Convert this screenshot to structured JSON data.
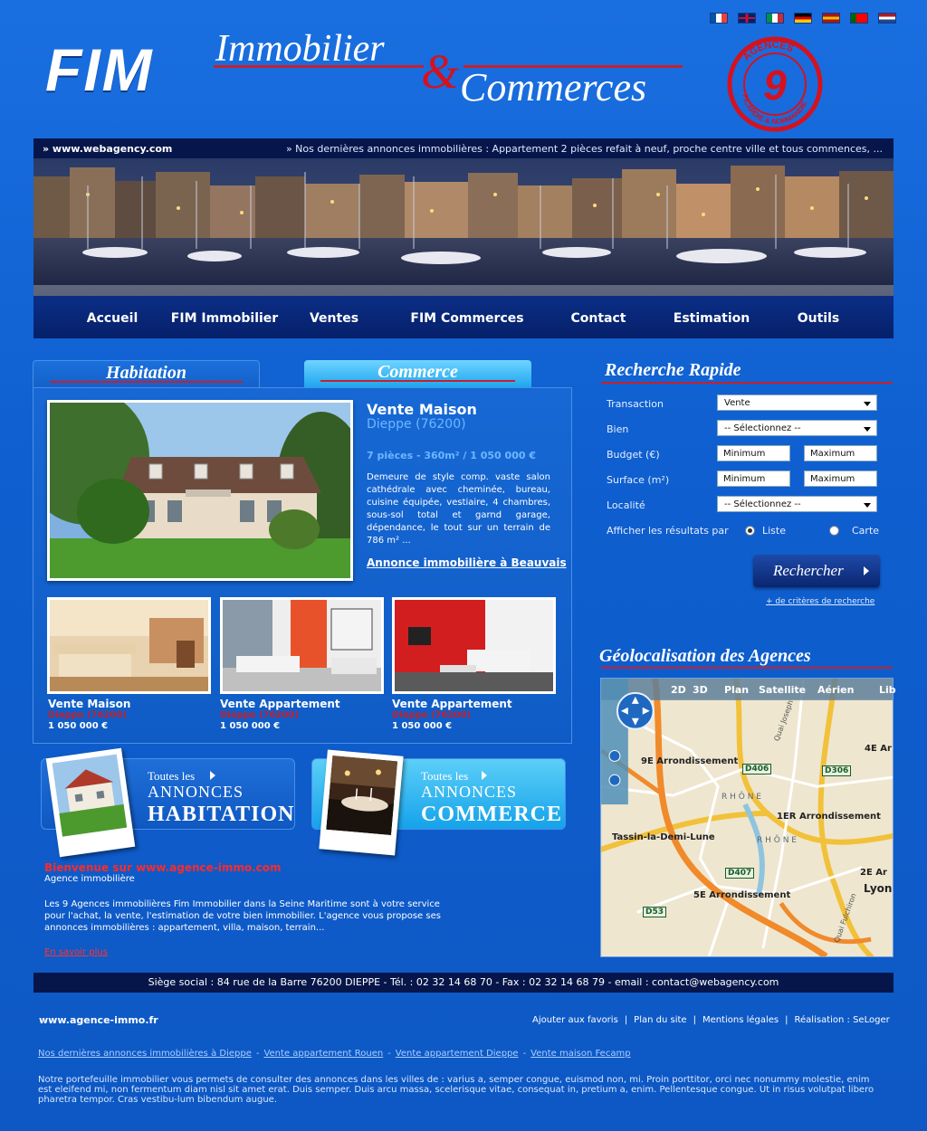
{
  "flags": [
    {
      "name": "french-flag",
      "colors": [
        "#0055a4",
        "#ffffff",
        "#ef4135"
      ],
      "orient": "v"
    },
    {
      "name": "uk-flag",
      "colors": [
        "#012169",
        "#ffffff",
        "#c8102e"
      ],
      "orient": "uk"
    },
    {
      "name": "italian-flag",
      "colors": [
        "#009246",
        "#ffffff",
        "#ce2b37"
      ],
      "orient": "v"
    },
    {
      "name": "german-flag",
      "colors": [
        "#000000",
        "#dd0000",
        "#ffce00"
      ],
      "orient": "h"
    },
    {
      "name": "spanish-flag",
      "colors": [
        "#aa151b",
        "#f1bf00",
        "#aa151b"
      ],
      "orient": "h"
    },
    {
      "name": "portuguese-flag",
      "colors": [
        "#006600",
        "#ff0000",
        "#ff0000"
      ],
      "orient": "v"
    },
    {
      "name": "dutch-flag",
      "colors": [
        "#ae1c28",
        "#ffffff",
        "#21468b"
      ],
      "orient": "h"
    }
  ],
  "logo": {
    "fim": "FIM",
    "immobilier": "Immobilier",
    "ampersand": "&",
    "commerces": "Commerces",
    "stamp_top": "AGENCES",
    "stamp_number": "9",
    "stamp_bottom": "PICARDIE & NORMANDIE"
  },
  "ticker": {
    "site": "» www.webagency.com",
    "news": "» Nos dernières annonces immobilières : Appartement 2 pièces refait à neuf, proche centre ville et tous commences, ..."
  },
  "nav": [
    {
      "label": "Accueil",
      "id": "accueil"
    },
    {
      "label": "FIM Immobilier",
      "id": "fim-immobilier"
    },
    {
      "label": "Ventes",
      "id": "ventes"
    },
    {
      "label": "FIM Commerces",
      "id": "fim-commerces"
    },
    {
      "label": "Contact",
      "id": "contact"
    },
    {
      "label": "Estimation",
      "id": "estimation"
    },
    {
      "label": "Outils",
      "id": "outils"
    }
  ],
  "tabs": {
    "habitation": "Habitation",
    "commerce": "Commerce"
  },
  "featured": {
    "title": "Vente Maison",
    "location": "Dieppe (76200)",
    "specs": "7 pièces - 360m² / 1 050 000 €",
    "description": "Demeure de style comp. vaste salon cathédrale avec cheminée, bureau, cuisine équipée, vestiaire, 4 chambres, sous-sol total et garnd garage, dépendance, le tout sur un terrain de 786 m² ...",
    "link": "Annonce immobilière à Beauvais"
  },
  "listings": [
    {
      "title": "Vente Maison",
      "location": "Dieppe (76200)",
      "price": "1 050 000 €"
    },
    {
      "title": "Vente Appartement",
      "location": "Dieppe (76200)",
      "price": "1 050 000 €"
    },
    {
      "title": "Vente Appartement",
      "location": "Dieppe (76200)",
      "price": "1 050 000 €"
    }
  ],
  "promos": {
    "habitation": {
      "small": "Toutes les",
      "mid": "ANNONCES",
      "big": "HABITATION"
    },
    "commerce": {
      "small": "Toutes les",
      "mid": "ANNONCES",
      "big": "COMMERCE"
    }
  },
  "welcome": {
    "title": "Bienvenue sur www.agence-immo.com",
    "subtitle": "Agence immobilière",
    "text": "Les 9 Agences immobilières Fim Immobilier dans la Seine Maritime sont à votre service pour l'achat, la vente, l'estimation de votre bien immobilier. L'agence vous propose ses annonces immobilières : appartement, villa, maison, terrain...",
    "more": "En savoir plus"
  },
  "search": {
    "title": "Recherche Rapide",
    "fields": [
      {
        "label": "Transaction",
        "type": "select",
        "value": "Vente"
      },
      {
        "label": "Bien",
        "type": "select",
        "value": "-- Sélectionnez --"
      },
      {
        "label": "Budget (€)",
        "type": "range",
        "min": "Minimum",
        "max": "Maximum"
      },
      {
        "label": "Surface (m²)",
        "type": "range",
        "min": "Minimum",
        "max": "Maximum"
      },
      {
        "label": "Localité",
        "type": "select",
        "value": "-- Sélectionnez --"
      }
    ],
    "display_label": "Afficher les résultats par",
    "display_options": [
      "Liste",
      "Carte"
    ],
    "display_selected": "Liste",
    "button": "Rechercher",
    "more_criteria": "+ de critères de recherche"
  },
  "geo": {
    "title": "Géolocalisation des Agences",
    "map_tabs": [
      "2D",
      "3D",
      "Plan",
      "Satellite",
      "Aérien",
      "Lib"
    ],
    "map_labels": {
      "arr9": "9E Arrondissement",
      "arr4": "4E Ar",
      "d406": "D406",
      "d306": "D306",
      "rhone1": "R H Ô N E",
      "arr1": "1ER Arrondissement",
      "tassin": "Tassin-la-Demi-Lune",
      "rhone2": "R H Ô N E",
      "d407": "D407",
      "arr2": "2E Ar",
      "lyon": "Lyon",
      "arr5": "5E Arrondissement",
      "d53": "D53",
      "quai1": "Quai Joseph",
      "quai2": "Quai Fulchiron"
    }
  },
  "footer": {
    "address": "Siège social : 84 rue de la Barre 76200 DIEPPE  - Tél. : 02 32 14 68 70 - Fax : 02 32 14 68 79 - email : contact@webagency.com",
    "site": "www.agence-immo.fr",
    "links": [
      "Ajouter aux favoris",
      "Plan du site",
      "Mentions légales",
      "Réalisation : SeLoger"
    ],
    "seo_links": [
      "Nos dernières annonces immobilières à Dieppe",
      "Vente appartement Rouen",
      "Vente appartement Dieppe",
      "Vente maison Fecamp"
    ],
    "seo_text": "Notre portefeuille immobilier vous permets de consulter des annonces dans les villes de : varius a, semper congue, euismod non, mi. Proin porttitor, orci nec nonummy molestie, enim est eleifend mi, non fermentum diam nisl sit amet erat. Duis semper. Duis arcu massa, scelerisque vitae, consequat in, pretium a, enim. Pellentesque congue. Ut in risus volutpat libero pharetra tempor. Cras vestibu-lum bibendum augue."
  },
  "colors": {
    "accent_red": "#c8202c",
    "background_blue": "#1466d6",
    "dark_navy": "#06164a",
    "light_blue_text": "#6bb7ff"
  }
}
